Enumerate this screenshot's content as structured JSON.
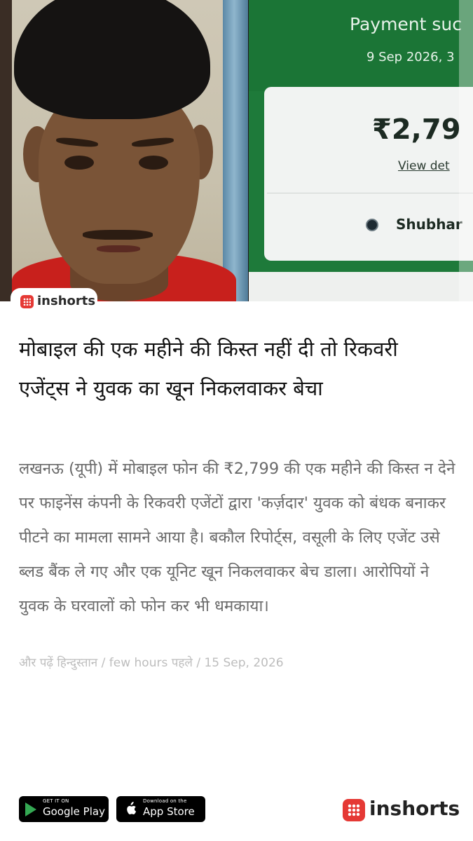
{
  "hero": {
    "payment_title": "Payment suc",
    "payment_date": "9 Sep 2026, 3",
    "payment_amount": "₹2,79",
    "payment_view": "View det",
    "payment_name": "Shubhar"
  },
  "badge": {
    "label": "inshorts"
  },
  "article": {
    "headline": "मोबाइल की एक महीने की किस्त नहीं दी तो रिकवरी एजेंट्स ने युवक का खून निकलवाकर बेचा",
    "body": "लखनऊ (यूपी) में मोबाइल फोन की ₹2,799 की एक महीने की किस्त न देने पर फाइनेंस कंपनी के रिकवरी एजेंटों द्वारा 'कर्ज़दार' युवक को बंधक बनाकर पीटने का मामला सामने आया है। बकौल रिपोर्ट्स, वसूली के लिए एजेंट उसे ब्लड बैंक ले गए और एक यूनिट खून निकलवाकर बेच डाला। आरोपियों ने युवक के घरवालों को फोन कर भी धमकाया।",
    "meta": "और पढ़ें हिन्दुस्तान / few hours पहले / 15 Sep, 2026"
  },
  "footer": {
    "google_play_small": "GET IT ON",
    "google_play_big": "Google Play",
    "app_store_small": "Download on the",
    "app_store_big": "App Store",
    "logo": "inshorts"
  },
  "colors": {
    "brand_red": "#e53935",
    "payment_green": "#1b7536"
  }
}
